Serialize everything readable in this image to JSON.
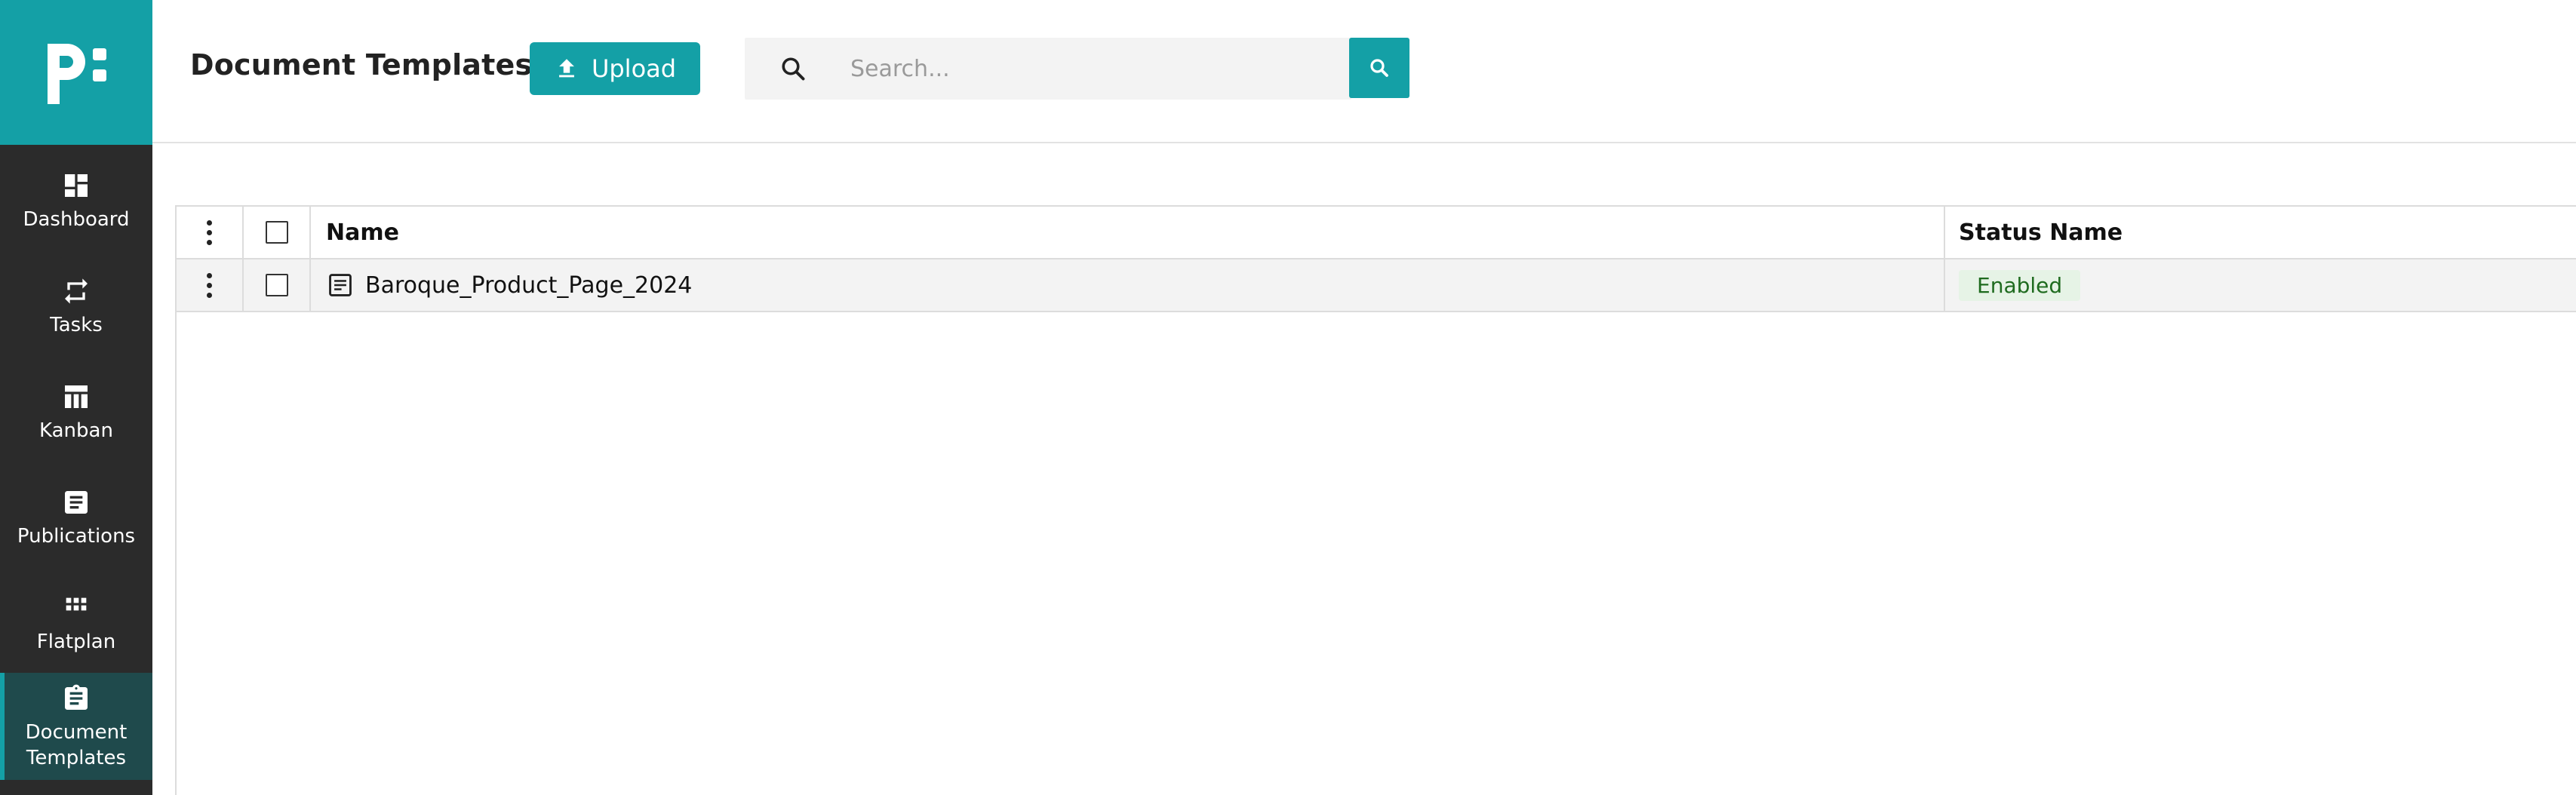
{
  "brand": {
    "accent": "#14a0a6",
    "sidebar_bg": "#2b2b2b",
    "active_bg": "#1f4a4c",
    "logo_icon": "p-colon-logo"
  },
  "sidebar": {
    "items": [
      {
        "label": "Dashboard",
        "icon": "dashboard-icon"
      },
      {
        "label": "Tasks",
        "icon": "swap-arrows-icon"
      },
      {
        "label": "Kanban",
        "icon": "kanban-board-icon"
      },
      {
        "label": "Publications",
        "icon": "document-text-icon"
      },
      {
        "label": "Flatplan",
        "icon": "grid-icon"
      },
      {
        "label": "Document Templates",
        "icon": "clipboard-icon",
        "active": true
      }
    ]
  },
  "header": {
    "title": "Document Templates",
    "upload_label": "Upload",
    "search_placeholder": "Search...",
    "search_value": ""
  },
  "table": {
    "columns": [
      "Name",
      "Status Name"
    ],
    "rows": [
      {
        "name": "Baroque_Product_Page_2024",
        "status": "Enabled",
        "status_color": "#1f6b1f",
        "status_bg": "#e6f3e6"
      }
    ]
  }
}
